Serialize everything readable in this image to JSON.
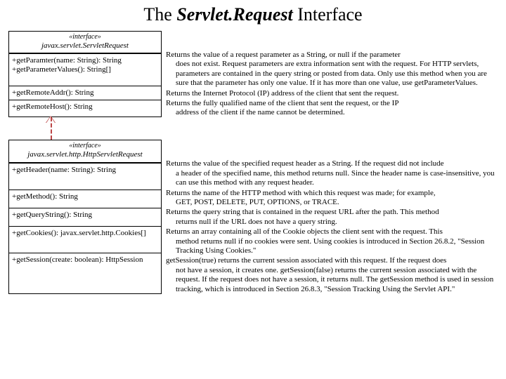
{
  "title_pre": "The ",
  "title_ital": "Servlet.Request",
  "title_post": " Interface",
  "uml1": {
    "stereo": "«interface»",
    "name": "javax.servlet.ServletRequest",
    "m1": "+getParamter(name: String): String",
    "m2": "+getParameterValues(): String[]",
    "m3": "+getRemoteAddr(): String",
    "m4": "+getRemoteHost(): String"
  },
  "uml2": {
    "stereo": "«interface»",
    "name": "javax.servlet.http.HttpServletRequest",
    "m1": "+getHeader(name: String): String",
    "m2": "+getMethod(): String",
    "m3": "+getQueryString(): String",
    "m4": "+getCookies(): javax.servlet.http.Cookies[]",
    "m5": "+getSession(create: boolean): HttpSession"
  },
  "desc": {
    "d1a": "Returns the value of a request parameter as a String, or null if the parameter",
    "d1b": "does not exist. Request parameters are extra information sent with the request. For HTTP servlets, parameters are contained in the query string or posted from data. Only use this method when you are sure that the parameter has only one value. If it has more than one value, use getParameterValues.",
    "d2": "Returns the Internet Protocol (IP) address of the client that sent the request.",
    "d3a": "Returns the fully qualified name of the client that sent the request, or the IP",
    "d3b": "address of the client if the name cannot be determined.",
    "d4a": "Returns the value of the specified request header as a String. If the request did not include",
    "d4b": "a header of the specified name, this method returns null. Since the header name is case-insensitive, you can use this method with any request header.",
    "d5a": "Returns the name of the HTTP method with which this request was made; for example,",
    "d5b": "GET, POST, DELETE, PUT, OPTIONS, or TRACE.",
    "d6a": "Returns the query string that is contained in the request URL after the path. This method",
    "d6b": "returns null if the URL does not have a query string.",
    "d7a": "Returns an array containing all of the Cookie objects the client sent with the request. This",
    "d7b": "method returns null if no cookies were sent. Using cookies is introduced in Section 26.8.2, \"Session Tracking Using Cookies.\"",
    "d8a": "getSession(true) returns the current session associated with this request. If the request does",
    "d8b": "not have a session, it creates one. getSession(false) returns the current session associated with the request. If the request does not have a session, it returns null. The getSession method is used in session tracking, which is introduced in Section 26.8.3, \"Session Tracking Using the Servlet API.\""
  }
}
